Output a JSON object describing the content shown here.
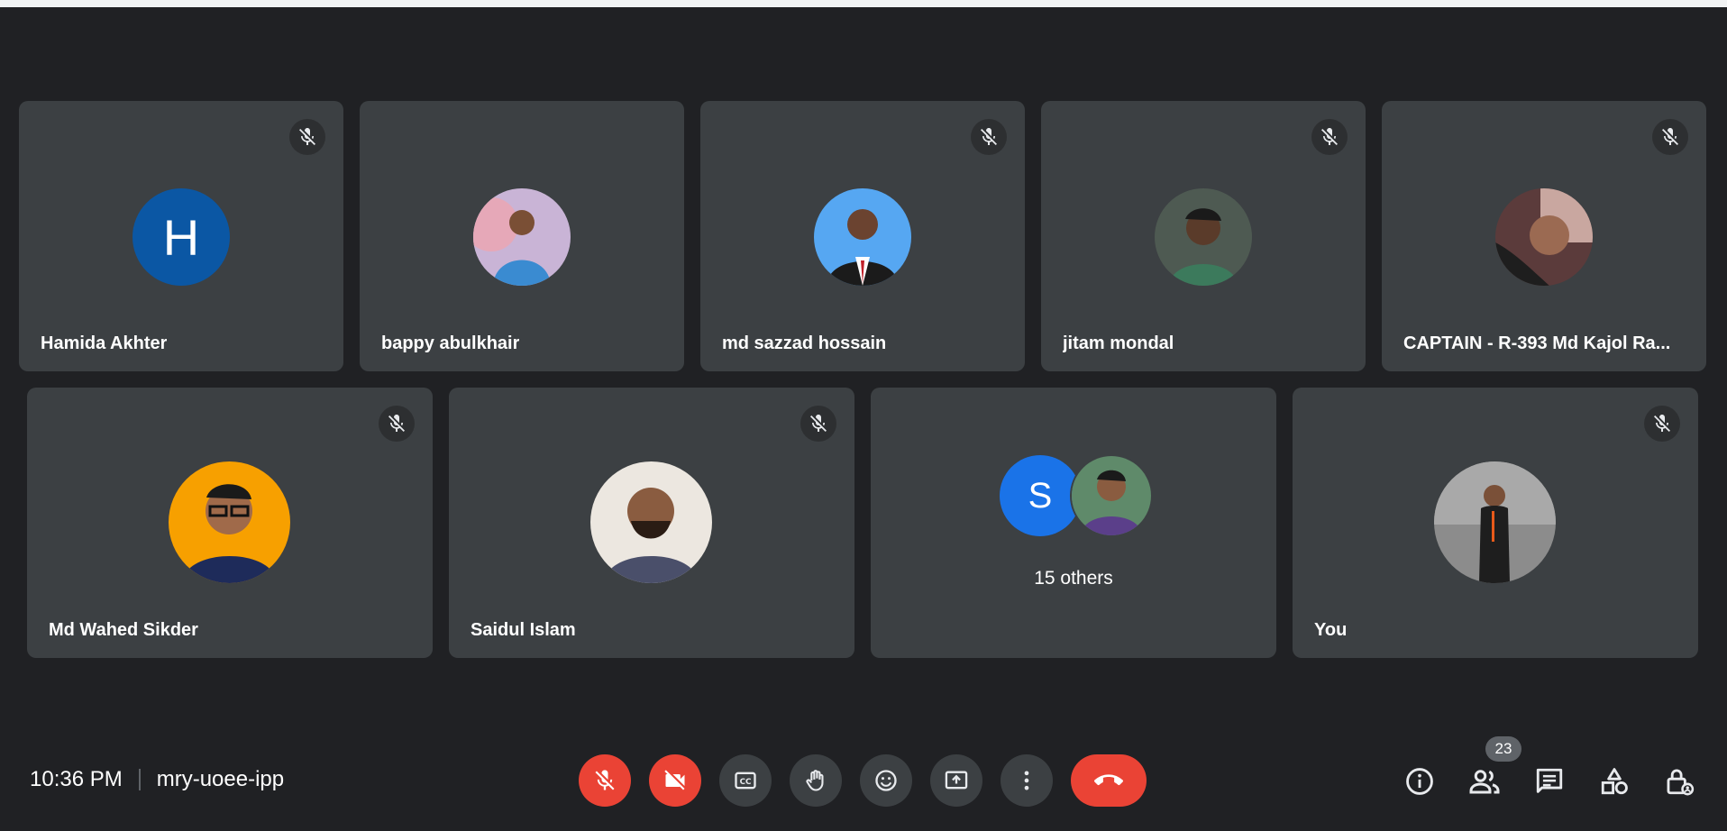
{
  "meeting": {
    "time": "10:36 PM",
    "code": "mry-uoee-ipp",
    "people_count": "23"
  },
  "participants": [
    {
      "name": "Hamida Akhter",
      "avatar_letter": "H",
      "avatar_color": "#0b57a4",
      "muted": true
    },
    {
      "name": "bappy abulkhair",
      "avatar": "photo",
      "muted": false
    },
    {
      "name": "md sazzad hossain",
      "avatar": "photo",
      "muted": true
    },
    {
      "name": "jitam mondal",
      "avatar": "photo",
      "muted": true
    },
    {
      "name": "CAPTAIN - R-393 Md Kajol Ra...",
      "avatar": "photo",
      "muted": true
    },
    {
      "name": "Md Wahed Sikder",
      "avatar": "photo",
      "muted": true
    },
    {
      "name": "Saidul Islam",
      "avatar": "photo",
      "muted": true
    },
    {
      "name": "You",
      "avatar": "photo",
      "muted": true
    }
  ],
  "others": {
    "label": "15 others",
    "avatar_letter": "S",
    "avatar_color": "#1a73e8"
  },
  "controls": {
    "mic": "mic-off-icon",
    "camera": "camera-off-icon",
    "captions": "closed-captions-icon",
    "hand": "raise-hand-icon",
    "reactions": "emoji-icon",
    "present": "present-screen-icon",
    "more": "more-options-icon",
    "leave": "hang-up-icon"
  },
  "side_controls": [
    "info-icon",
    "people-icon",
    "chat-icon",
    "activities-icon",
    "host-controls-icon"
  ],
  "colors": {
    "background": "#202124",
    "tile": "#3c4043",
    "danger": "#ea4335"
  }
}
